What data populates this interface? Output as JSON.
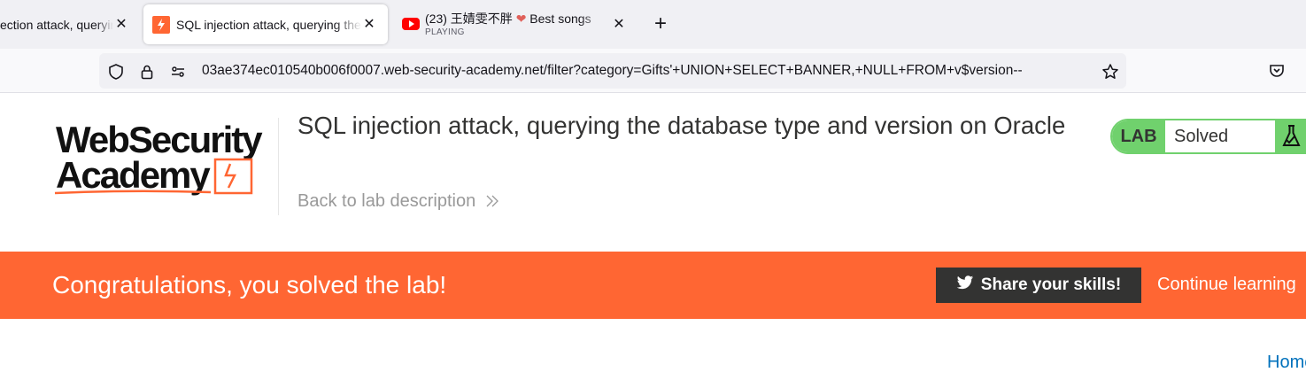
{
  "browser": {
    "tabs": [
      {
        "title": "ection attack, querying the",
        "close": "✕"
      },
      {
        "title": "SQL injection attack, querying the",
        "close": "✕"
      },
      {
        "title_prefix": "(23) 王婧雯不胖 ",
        "heart": "❤",
        "title_suffix": " Best songs",
        "subtitle": "PLAYING",
        "close": "✕"
      }
    ],
    "new_tab": "+",
    "url": "03ae374ec010540b006f0007.web-security-academy.net/filter?category=Gifts'+UNION+SELECT+BANNER,+NULL+FROM+v$version--"
  },
  "header": {
    "logo_line1": "WebSecurity",
    "logo_line2": "Academy",
    "title": "SQL injection attack, querying the database type and version on Oracle",
    "back_link": "Back to lab description",
    "status_tag": "LAB",
    "status_value": "Solved"
  },
  "banner": {
    "message": "Congratulations, you solved the lab!",
    "share_label": "Share your skills!",
    "continue_label": "Continue learning"
  },
  "nav": {
    "home": "Home"
  },
  "colors": {
    "accent": "#ff6633",
    "solved": "#70d16d",
    "dark": "#333332",
    "link": "#0071bc"
  }
}
